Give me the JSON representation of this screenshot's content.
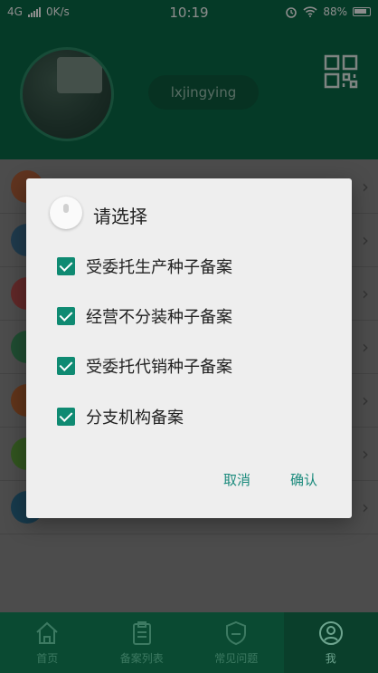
{
  "status_bar": {
    "network": "4G",
    "speed": "0K/s",
    "time": "10:19",
    "battery": "88%"
  },
  "profile": {
    "username": "lxjingying"
  },
  "list": {
    "rows": [
      {
        "color": "#b0603a"
      },
      {
        "color": "#3a6a8a"
      },
      {
        "color": "#b04a4a"
      },
      {
        "color": "#3a8a5a"
      },
      {
        "color": "#b06030"
      },
      {
        "color": "#5a9a3a"
      },
      {
        "color": "#2a6a8a"
      }
    ]
  },
  "dialog": {
    "title": "请选择",
    "options": [
      {
        "label": "受委托生产种子备案",
        "checked": true
      },
      {
        "label": "经营不分装种子备案",
        "checked": true
      },
      {
        "label": "受委托代销种子备案",
        "checked": true
      },
      {
        "label": "分支机构备案",
        "checked": true
      }
    ],
    "cancel_label": "取消",
    "confirm_label": "确认"
  },
  "tabbar": {
    "tabs": [
      {
        "label": "首页",
        "icon": "home-icon"
      },
      {
        "label": "备案列表",
        "icon": "clipboard-icon"
      },
      {
        "label": "常见问题",
        "icon": "shield-icon"
      },
      {
        "label": "我",
        "icon": "person-icon"
      }
    ],
    "active_index": 3
  },
  "colors": {
    "primary": "#0a6b47",
    "accent": "#0f8a72",
    "button_text": "#1a8a7c"
  }
}
